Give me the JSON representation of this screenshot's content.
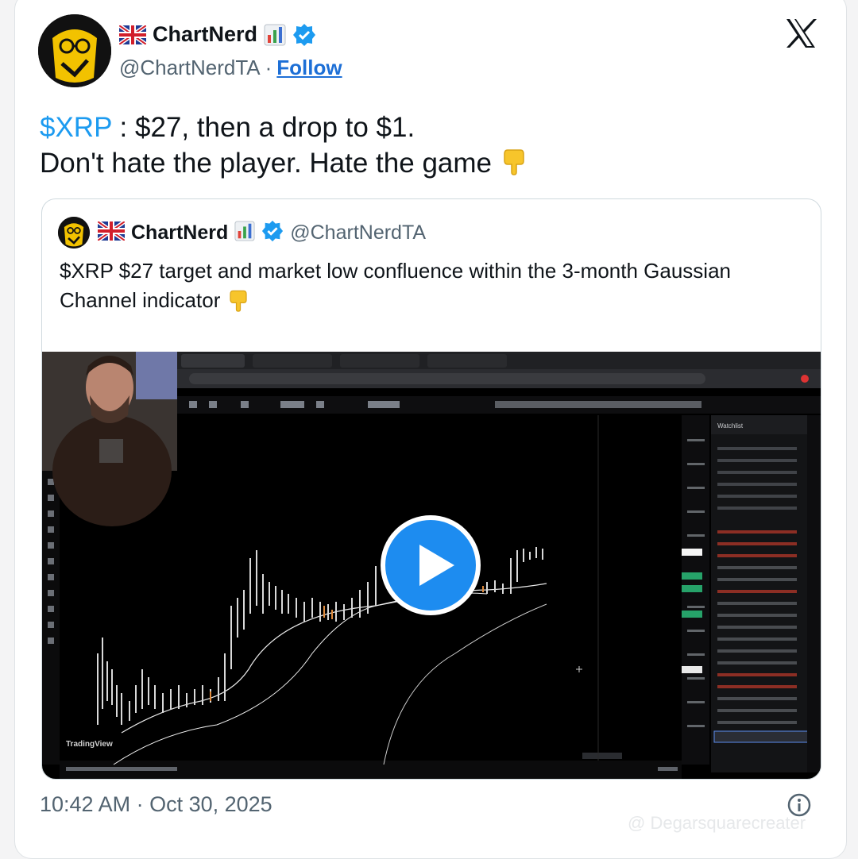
{
  "author": {
    "name": "ChartNerd",
    "handle": "@ChartNerdTA",
    "separator": "·",
    "follow_label": "Follow"
  },
  "tweet": {
    "cashtag": "$XRP",
    "line1_rest": " : $27, then a drop to $1.",
    "line2": "Don't hate the player. Hate the game"
  },
  "quoted": {
    "name": "ChartNerd",
    "handle": "@ChartNerdTA",
    "text": "$XRP $27 target and market low confluence within the 3-month Gaussian Channel indicator"
  },
  "media": {
    "watermark_text": "TradingView",
    "watchlist_title": "Watchlist"
  },
  "footer": {
    "timestamp": "10:42 AM · Oct 30, 2025"
  },
  "overlay": {
    "watermark": "@ Degarsquarecreater"
  },
  "icons": {
    "platform": "x-logo-icon",
    "verified": "verified-badge-icon",
    "flag": "uk-flag-icon",
    "chart": "bar-chart-emoji-icon",
    "pointing": "pointing-down-emoji-icon",
    "play": "play-icon",
    "info": "info-icon"
  },
  "colors": {
    "link": "#1d9bf0",
    "follow": "#1d6fd6",
    "verified": "#1d9bf0",
    "play_button": "#1d8cf0"
  }
}
